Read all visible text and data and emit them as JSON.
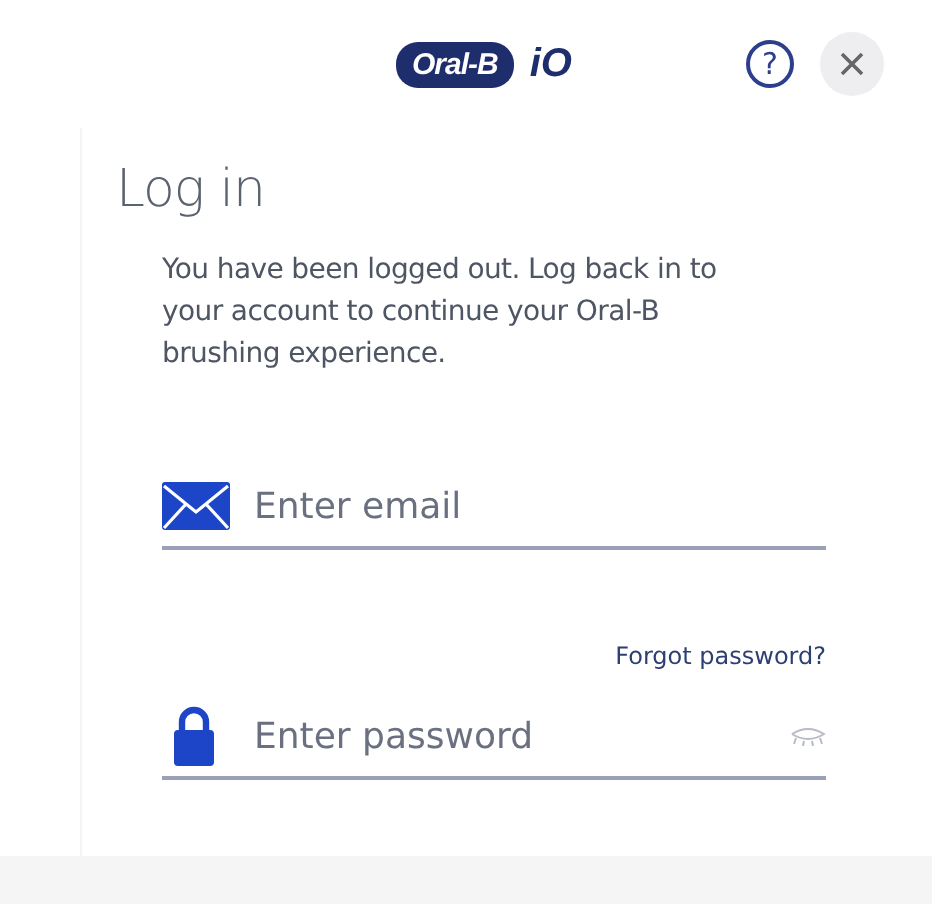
{
  "header": {
    "brand": "Oral-B",
    "product": "iO",
    "help": "?"
  },
  "title": "Log in",
  "message": "You have been logged out. Log back in to your account to continue your Oral-B brushing experience.",
  "email": {
    "placeholder": "Enter email"
  },
  "forgot_link": "Forgot password?",
  "password": {
    "placeholder": "Enter password"
  }
}
